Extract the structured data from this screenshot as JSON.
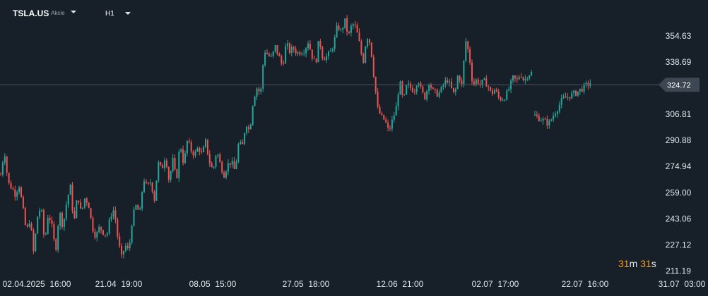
{
  "header": {
    "symbol": "TSLA.US",
    "instrument_type": "Akcie",
    "timeframe": "H1"
  },
  "countdown": {
    "minutes": "31",
    "m_unit": "m",
    "seconds": "31",
    "s_unit": "s"
  },
  "colors": {
    "background": "#172028",
    "up": "#26a69a",
    "down": "#ef5350",
    "axis_text": "#dfe5ea",
    "current_price_label_bg": "#3c4753",
    "countdown_number": "#f59a23"
  },
  "chart_data": {
    "type": "candlestick",
    "current_price": 324.72,
    "current_price_label": "324.72",
    "y_ticks": [
      "354.63",
      "338.69",
      "306.81",
      "290.88",
      "274.94",
      "259.00",
      "243.06",
      "227.12",
      "211.19"
    ],
    "x_ticks": [
      "02.04.2025  16:00",
      "21.04  19:00",
      "08.05  15:00",
      "27.05  18:00",
      "12.06  21:00",
      "02.07  17:00",
      "22.07  16:00",
      "31.07  03:00"
    ],
    "ylim": [
      208,
      367
    ],
    "grid": false,
    "segments": [
      {
        "x": [
          0.0,
          0.9
        ],
        "path": [
          270,
          285,
          265,
          262,
          258,
          264,
          250,
          235,
          243,
          222,
          244,
          251,
          228,
          247,
          238,
          223,
          248,
          238,
          253,
          263,
          240,
          258,
          246,
          256,
          252,
          238,
          232,
          238,
          235,
          233,
          245,
          249,
          231,
          219,
          227,
          223,
          244,
          251,
          246,
          268,
          262,
          266,
          255,
          277,
          273,
          282,
          266,
          279,
          266,
          290,
          276,
          291,
          285,
          282,
          287,
          282,
          290,
          278,
          272,
          285,
          276,
          270,
          276,
          278,
          272,
          289,
          287,
          302,
          296,
          316,
          323,
          319,
          346,
          343,
          341,
          348,
          342,
          336,
          350,
          345,
          347,
          344,
          345,
          346,
          351,
          343,
          337,
          353,
          341,
          342,
          344,
          350,
          361,
          357,
          364,
          354,
          362,
          360,
          350,
          338,
          355,
          350,
          329,
          310,
          305,
          303,
          296,
          303,
          310,
          327,
          314,
          325,
          323,
          321,
          329,
          320,
          317,
          327,
          321,
          319,
          320,
          325,
          328,
          323,
          318,
          332,
          324,
          352,
          343,
          324,
          328,
          325,
          327,
          325,
          319,
          322,
          317,
          316,
          318,
          323,
          329,
          327,
          332,
          327,
          331,
          332
        ]
      },
      {
        "x": [
          0.9,
          1.0
        ],
        "path": [
          306,
          301,
          316,
          320,
          326
        ]
      }
    ]
  }
}
